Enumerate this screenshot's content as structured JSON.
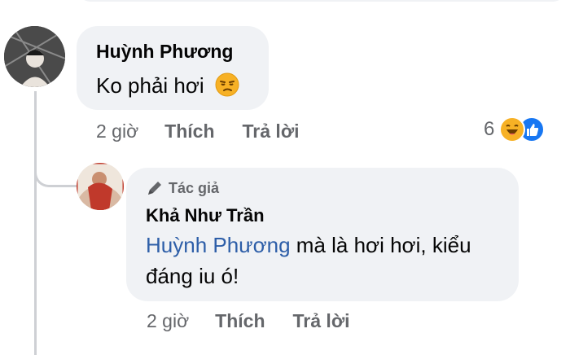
{
  "comment": {
    "author": "Huỳnh Phương",
    "text": "Ko phải hơi",
    "emoji": "😒",
    "time": "2 giờ",
    "like_label": "Thích",
    "reply_label": "Trả lời",
    "reaction_count": "6",
    "reactions": [
      "haha-icon",
      "like-icon"
    ]
  },
  "reply": {
    "badge": "Tác giả",
    "author": "Khả Như Trần",
    "mention": "Huỳnh Phương",
    "text_line1": " mà là hơi hơi, kiểu",
    "text_line2": "đáng iu ó!",
    "time": "2 giờ",
    "like_label": "Thích",
    "reply_label": "Trả lời"
  },
  "colors": {
    "bubble": "#f0f2f5",
    "secondary_text": "#65676b",
    "mention": "#2d5ea8",
    "like_blue": "#1877f2",
    "haha_yellow": "#f7b125"
  }
}
